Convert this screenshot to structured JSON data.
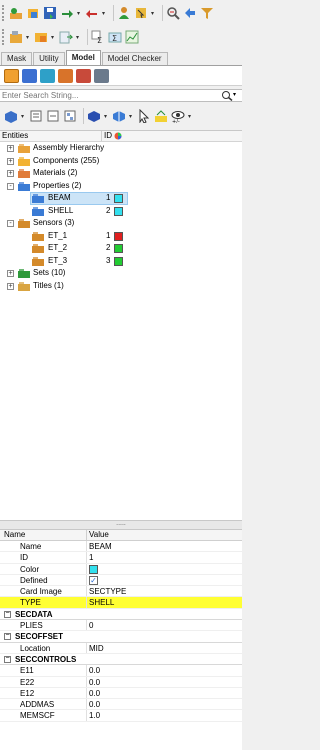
{
  "toolbar": {
    "row1_icons": [
      "model-icon",
      "component-icon",
      "save-icon",
      "import-icon",
      "export-icon",
      "user-icon",
      "select-icon",
      "zoom-icon",
      "back-arrow-icon",
      "funnel-icon"
    ],
    "row2_icons": [
      "group-icon",
      "assembly-icon",
      "load-icon",
      "sum-icon",
      "sigma-icon",
      "graph-icon"
    ]
  },
  "tabs": [
    {
      "label": "Mask"
    },
    {
      "label": "Utility"
    },
    {
      "label": "Model"
    },
    {
      "label": "Model Checker"
    }
  ],
  "search": {
    "placeholder": "Enter Search String..."
  },
  "tree": {
    "header": {
      "entities": "Entities",
      "id": "ID"
    },
    "rows": [
      {
        "label": "Assembly Hierarchy",
        "level": 0,
        "expander": "+",
        "icon": "assembly-icon"
      },
      {
        "label": "Components (255)",
        "level": 0,
        "expander": "+",
        "icon": "component-icon"
      },
      {
        "label": "Materials (2)",
        "level": 0,
        "expander": "+",
        "icon": "material-icon"
      },
      {
        "label": "Properties (2)",
        "level": 0,
        "expander": "-",
        "icon": "property-icon"
      },
      {
        "label": "BEAM",
        "level": 1,
        "id": "1",
        "color": "#33e0ee",
        "icon": "property-icon",
        "selected": true
      },
      {
        "label": "SHELL",
        "level": 1,
        "id": "2",
        "color": "#33e0ee",
        "icon": "property-icon"
      },
      {
        "label": "Sensors (3)",
        "level": 0,
        "expander": "-",
        "icon": "sensor-icon"
      },
      {
        "label": "ET_1",
        "level": 1,
        "id": "1",
        "color": "#e02020",
        "icon": "sensor-icon"
      },
      {
        "label": "ET_2",
        "level": 1,
        "id": "2",
        "color": "#22cc33",
        "icon": "sensor-icon"
      },
      {
        "label": "ET_3",
        "level": 1,
        "id": "3",
        "color": "#22cc33",
        "icon": "sensor-icon"
      },
      {
        "label": "Sets (10)",
        "level": 0,
        "expander": "+",
        "icon": "set-icon"
      },
      {
        "label": "Titles (1)",
        "level": 0,
        "expander": "+",
        "icon": "title-icon"
      }
    ]
  },
  "props": {
    "header": {
      "name": "Name",
      "value": "Value"
    },
    "rows": [
      {
        "type": "row",
        "name": "Name",
        "value": "BEAM"
      },
      {
        "type": "row",
        "name": "ID",
        "value": "1"
      },
      {
        "type": "row",
        "name": "Color",
        "value": "",
        "swatch": "#33e0ee"
      },
      {
        "type": "row",
        "name": "Defined",
        "value": "",
        "check": "✓"
      },
      {
        "type": "row",
        "name": "Card Image",
        "value": "SECTYPE"
      },
      {
        "type": "row",
        "name": "TYPE",
        "value": "SHELL",
        "highlight": true
      },
      {
        "type": "section",
        "name": "SECDATA"
      },
      {
        "type": "row",
        "name": "PLIES",
        "value": "0"
      },
      {
        "type": "section",
        "name": "SECOFFSET"
      },
      {
        "type": "row",
        "name": "Location",
        "value": "MID"
      },
      {
        "type": "section",
        "name": "SECCONTROLS"
      },
      {
        "type": "row",
        "name": "E11",
        "value": "0.0"
      },
      {
        "type": "row",
        "name": "E22",
        "value": "0.0"
      },
      {
        "type": "row",
        "name": "E12",
        "value": "0.0"
      },
      {
        "type": "row",
        "name": "ADDMAS",
        "value": "0.0"
      },
      {
        "type": "row",
        "name": "MEMSCF",
        "value": "1.0"
      }
    ]
  }
}
